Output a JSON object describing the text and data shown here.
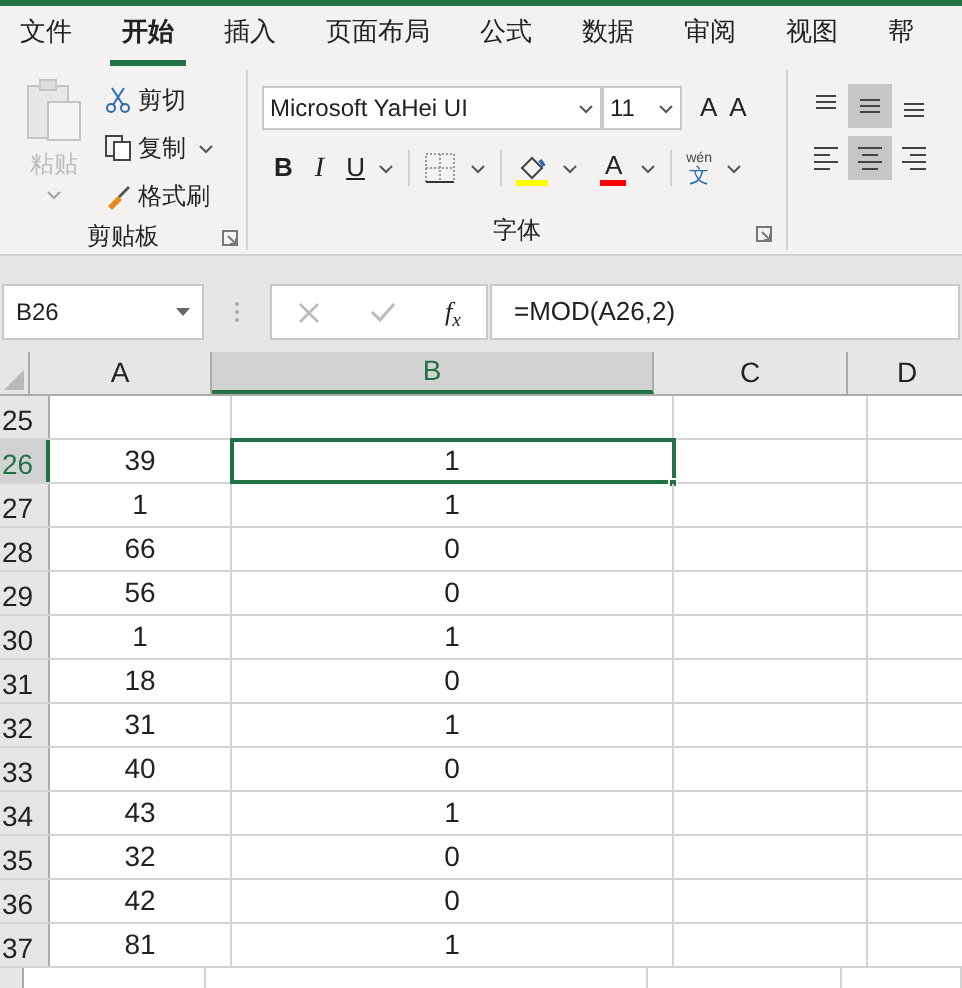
{
  "tabs": [
    {
      "label": "文件",
      "selected": false
    },
    {
      "label": "开始",
      "selected": true
    },
    {
      "label": "插入",
      "selected": false
    },
    {
      "label": "页面布局",
      "selected": false
    },
    {
      "label": "公式",
      "selected": false
    },
    {
      "label": "数据",
      "selected": false
    },
    {
      "label": "审阅",
      "selected": false
    },
    {
      "label": "视图",
      "selected": false
    },
    {
      "label": "帮",
      "selected": false
    }
  ],
  "clipboard": {
    "paste": {
      "label": "粘贴",
      "disabled": true
    },
    "items": [
      {
        "label": "剪切",
        "kind": "cut",
        "dropdown": false
      },
      {
        "label": "复制",
        "kind": "copy",
        "dropdown": true
      },
      {
        "label": "格式刷",
        "kind": "brush",
        "dropdown": false
      }
    ],
    "group_label": "剪贴板"
  },
  "font": {
    "name": "Microsoft YaHei UI",
    "size": "11",
    "grow": "A",
    "shrink": "A",
    "bold": "B",
    "italic": "I",
    "underline": "U",
    "font_color": "A",
    "phonetic_top": "wén",
    "phonetic_bottom": "文",
    "group_label": "字体"
  },
  "align": [
    {
      "kind": "top",
      "selected": false
    },
    {
      "kind": "middle",
      "selected": true
    },
    {
      "kind": "bottom",
      "selected": false
    },
    {
      "kind": "left",
      "selected": false
    },
    {
      "kind": "center",
      "selected": true
    },
    {
      "kind": "right",
      "selected": false
    }
  ],
  "formula_bar": {
    "name_box": "B26",
    "fx": "f$_{x}$",
    "formula": "=MOD(A26,2)"
  },
  "sheet": {
    "columns": [
      {
        "label": "A",
        "selected": false
      },
      {
        "label": "B",
        "selected": true
      },
      {
        "label": "C",
        "selected": false
      },
      {
        "label": "D",
        "selected": false
      }
    ],
    "rows": [
      {
        "num": "25",
        "selected": false,
        "cells": []
      },
      {
        "num": "26",
        "selected": true,
        "cells": [
          "39",
          "1"
        ]
      },
      {
        "num": "27",
        "selected": false,
        "cells": [
          "1",
          "1"
        ]
      },
      {
        "num": "28",
        "selected": false,
        "cells": [
          "66",
          "0"
        ]
      },
      {
        "num": "29",
        "selected": false,
        "cells": [
          "56",
          "0"
        ]
      },
      {
        "num": "30",
        "selected": false,
        "cells": [
          "1",
          "1"
        ]
      },
      {
        "num": "31",
        "selected": false,
        "cells": [
          "18",
          "0"
        ]
      },
      {
        "num": "32",
        "selected": false,
        "cells": [
          "31",
          "1"
        ]
      },
      {
        "num": "33",
        "selected": false,
        "cells": [
          "40",
          "0"
        ]
      },
      {
        "num": "34",
        "selected": false,
        "cells": [
          "43",
          "1"
        ]
      },
      {
        "num": "35",
        "selected": false,
        "cells": [
          "32",
          "0"
        ]
      },
      {
        "num": "36",
        "selected": false,
        "cells": [
          "42",
          "0"
        ]
      },
      {
        "num": "37",
        "selected": false,
        "cells": [
          "81",
          "1"
        ]
      }
    ]
  }
}
